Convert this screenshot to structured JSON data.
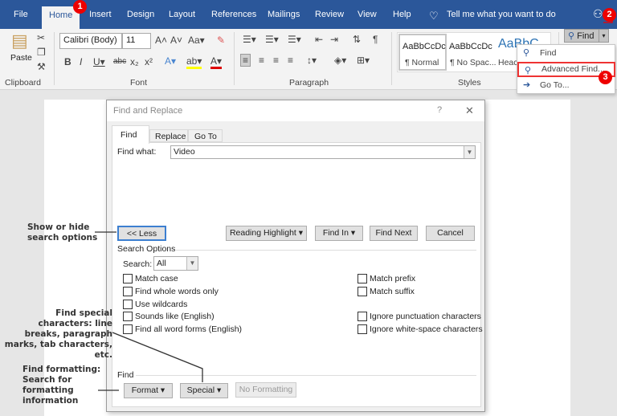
{
  "tabs": [
    "File",
    "Home",
    "Insert",
    "Design",
    "Layout",
    "References",
    "Mailings",
    "Review",
    "View",
    "Help"
  ],
  "tell_me": "Tell me what you want to do",
  "ribbon": {
    "paste": "Paste",
    "font_name": "Calibri (Body)",
    "font_size": "11",
    "groups": [
      "Clipboard",
      "Font",
      "Paragraph",
      "Styles"
    ],
    "styles": [
      {
        "preview": "AaBbCcDc",
        "name": "¶ Normal"
      },
      {
        "preview": "AaBbCcDc",
        "name": "¶ No Spac..."
      },
      {
        "preview": "AaBbC",
        "name": "Heac"
      }
    ],
    "find_button": "Find"
  },
  "find_menu": {
    "items": [
      {
        "label": "Find",
        "icon": "search-icon"
      },
      {
        "label": "Advanced Find...",
        "icon": "search-icon",
        "highlighted": true
      },
      {
        "label": "Go To...",
        "icon": "arrow-right-icon"
      }
    ]
  },
  "badges": [
    "1",
    "2",
    "3"
  ],
  "dialog": {
    "title": "Find and Replace",
    "help": "?",
    "close": "✕",
    "tabs": [
      "Find",
      "Replace",
      "Go To"
    ],
    "find_what_label": "Find what:",
    "find_what_value": "Video",
    "buttons": {
      "less": "<< Less",
      "reading_highlight": "Reading Highlight ▾",
      "find_in": "Find In ▾",
      "find_next": "Find Next",
      "cancel": "Cancel"
    },
    "search_options_label": "Search Options",
    "search_label": "Search:",
    "search_value": "All",
    "options_left": [
      "Match case",
      "Find whole words only",
      "Use wildcards",
      "Sounds like (English)",
      "Find all word forms (English)"
    ],
    "options_right": [
      "Match prefix",
      "Match suffix",
      "Ignore punctuation characters",
      "Ignore white-space characters"
    ],
    "find_section": "Find",
    "format": "Format ▾",
    "special": "Special ▾",
    "no_formatting": "No Formatting"
  },
  "annotations": {
    "less": "Show or hide search options",
    "special": "Find special characters: line breaks, paragraph marks, tab characters, etc.",
    "format": "Find formatting: Search for formatting information"
  },
  "colors": {
    "accent": "#2b579a",
    "badge": "#e00000"
  }
}
